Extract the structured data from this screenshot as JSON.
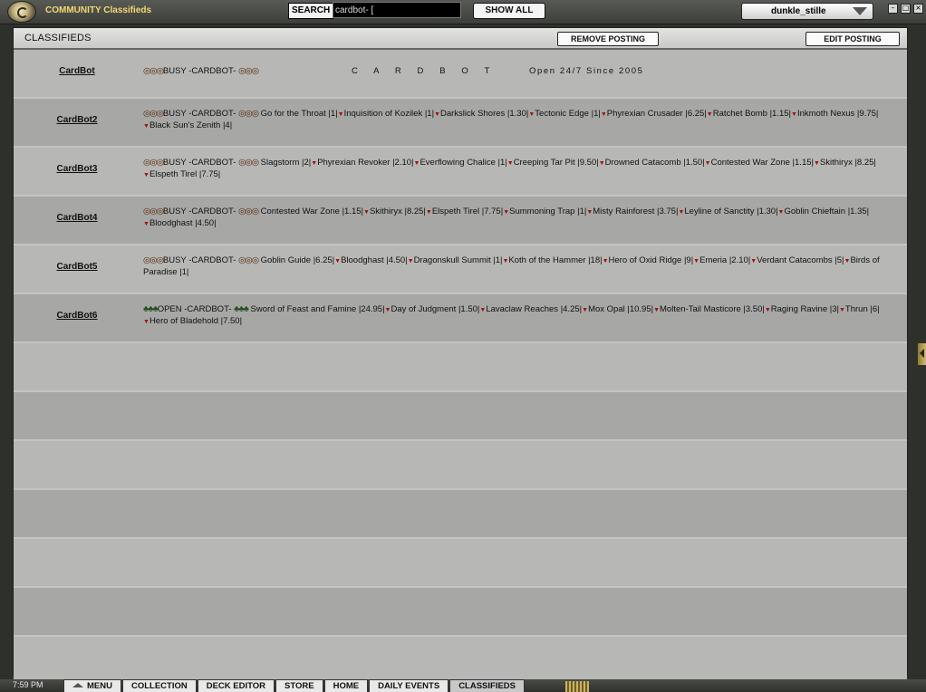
{
  "topbar": {
    "app_title": "COMMUNITY Classifieds",
    "search_label": "SEARCH",
    "search_value": "cardbot- [",
    "show_all_label": "SHOW ALL",
    "user_name": "dunkle_stille",
    "window_controls": [
      "–",
      "□",
      "×"
    ]
  },
  "panel": {
    "title": "CLASSIFIEDS",
    "remove_label": "REMOVE POSTING",
    "edit_label": "EDIT POSTING"
  },
  "postings": [
    {
      "name": "CardBot",
      "status_prefix": "BUSY -CARDBOT-",
      "banner_1": "C A R D B O T",
      "banner_2": "Open 24/7 Since 2005"
    },
    {
      "name": "CardBot2",
      "status_prefix": "BUSY -CARDBOT-",
      "items": [
        "Go for the Throat |1|",
        "Inquisition of Kozilek |1|",
        "Darkslick Shores |1.30|",
        "Tectonic Edge |1|",
        "Phyrexian Crusader |6.25|",
        "Ratchet Bomb |1.15|",
        "Inkmoth Nexus |9.75|",
        "Black Sun's Zenith |4|"
      ]
    },
    {
      "name": "CardBot3",
      "status_prefix": "BUSY -CARDBOT-",
      "items": [
        "Slagstorm |2|",
        "Phyrexian Revoker |2.10|",
        "Everflowing Chalice |1|",
        "Creeping Tar Pit |9.50|",
        "Drowned Catacomb |1.50|",
        "Contested War Zone |1.15|",
        "Skithiryx |8.25|",
        "Elspeth Tirel |7.75|"
      ]
    },
    {
      "name": "CardBot4",
      "status_prefix": "BUSY -CARDBOT-",
      "items": [
        "Contested War Zone |1.15|",
        "Skithiryx |8.25|",
        "Elspeth Tirel |7.75|",
        "Summoning Trap |1|",
        "Misty Rainforest |3.75|",
        "Leyline of Sanctity |1.30|",
        "Goblin Chieftain |1.35|",
        "Bloodghast |4.50|"
      ]
    },
    {
      "name": "CardBot5",
      "status_prefix": "BUSY -CARDBOT-",
      "items": [
        "Goblin Guide |6.25|",
        "Bloodghast |4.50|",
        "Dragonskull Summit |1|",
        "Koth of the Hammer |18|",
        "Hero of Oxid Ridge |9|",
        "Emeria |2.10|",
        "Verdant Catacombs |5|",
        "Birds of Paradise |1|"
      ]
    },
    {
      "name": "CardBot6",
      "status_prefix": "OPEN -CARDBOT-",
      "items": [
        "Sword of Feast and Famine |24.95|",
        "Day of Judgment |1.50|",
        "Lavaclaw Reaches |4.25|",
        "Mox Opal |10.95|",
        "Molten-Tail Masticore |3.50|",
        "Raging Ravine |3|",
        "Thrun |6|",
        "Hero of Bladehold |7.50|"
      ]
    }
  ],
  "empty_rows": 7,
  "bottombar": {
    "clock": "7:59 PM",
    "tabs": [
      "MENU",
      "COLLECTION",
      "DECK EDITOR",
      "STORE",
      "HOME",
      "DAILY EVENTS",
      "CLASSIFIEDS"
    ],
    "active_tab": "CLASSIFIEDS"
  },
  "colors": {
    "accent_title": "#f3d874",
    "item_arrow": "#a11010",
    "busy_symbol": "#5a2e10",
    "open_symbol": "#1d4a1d"
  },
  "icons": {
    "logo": "planeswalker-logo-icon",
    "busy_marker": "busy-swirl-icon",
    "open_marker": "open-tree-icon",
    "item_marker": "red-triangle-icon"
  }
}
